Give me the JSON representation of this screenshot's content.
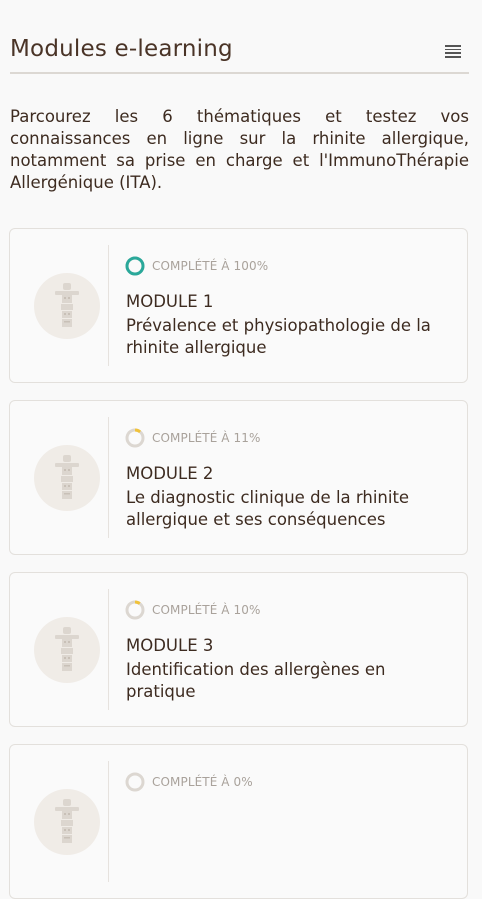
{
  "header": {
    "title": "Modules e-learning",
    "menu_icon": "hamburger-menu-icon"
  },
  "intro": "Parcourez les 6 thématiques et testez vos connaissances en ligne sur la rhinite allergique, notamment sa prise en charge et l'ImmunoThérapie Allergénique (ITA).",
  "colors": {
    "complete": "#2aa89a",
    "in_progress": "#f0c23a",
    "ring_track": "#dcd7d1"
  },
  "modules": [
    {
      "status": "COMPLÉTÉ À 100%",
      "progress": 1.0,
      "label": "MODULE 1",
      "title": "Prévalence et physiopathologie de la rhinite allergique",
      "icon": "totem-icon"
    },
    {
      "status": "COMPLÉTÉ À 11%",
      "progress": 0.11,
      "label": "MODULE 2",
      "title": "Le diagnostic clinique de la rhinite allergique et ses conséquences",
      "icon": "totem-icon"
    },
    {
      "status": "COMPLÉTÉ À 10%",
      "progress": 0.1,
      "label": "MODULE 3",
      "title": "Identification des allergènes en pratique",
      "icon": "totem-icon"
    },
    {
      "status": "COMPLÉTÉ À 0%",
      "progress": 0.0,
      "label": "",
      "title": "",
      "icon": "totem-icon"
    }
  ]
}
